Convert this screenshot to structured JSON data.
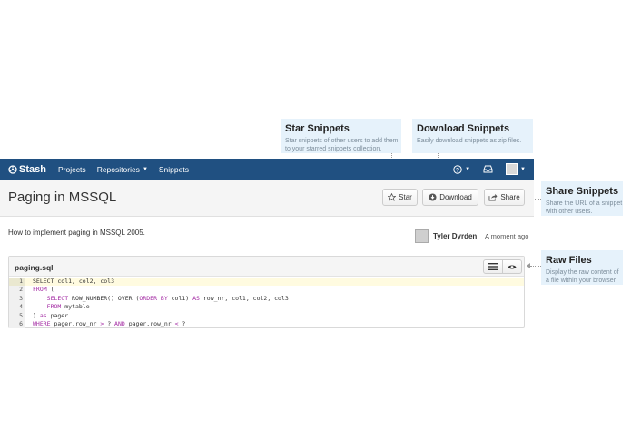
{
  "callouts": {
    "star": {
      "title": "Star Snippets",
      "desc1": "Star snippets of other users to add them",
      "desc2": "to your starred snippets collection."
    },
    "download": {
      "title": "Download Snippets",
      "desc1": "Easily download snippets as zip files."
    },
    "share": {
      "title": "Share Snippets",
      "desc1": "Share the URL of a snippet",
      "desc2": "with other users."
    },
    "raw": {
      "title": "Raw Files",
      "desc1": "Display the raw content of",
      "desc2": "a file within your browser."
    }
  },
  "navbar": {
    "brand": "Stash",
    "items": [
      "Projects",
      "Repositories",
      "Snippets"
    ],
    "help_icon": "help-icon",
    "inbox_icon": "inbox-icon",
    "colors": {
      "bar": "#205081"
    }
  },
  "header": {
    "title": "Paging in MSSQL",
    "star_label": "Star",
    "download_label": "Download",
    "share_label": "Share"
  },
  "snippet": {
    "description": "How to implement paging in MSSQL 2005.",
    "author": "Tyler Dyrden",
    "timestamp": "A moment ago"
  },
  "file": {
    "name": "paging.sql",
    "lines": [
      {
        "num": "1",
        "tokens": [
          [
            "",
            "SELECT col1, col2, col3"
          ]
        ]
      },
      {
        "num": "2",
        "tokens": [
          [
            "kw",
            "FROM"
          ],
          [
            "",
            " ("
          ]
        ]
      },
      {
        "num": "3",
        "tokens": [
          [
            "",
            "    "
          ],
          [
            "kw",
            "SELECT"
          ],
          [
            "",
            " ROW_NUMBER() OVER ("
          ],
          [
            "kw",
            "ORDER BY"
          ],
          [
            "",
            " col1) "
          ],
          [
            "kw",
            "AS"
          ],
          [
            "",
            " row_nr, col1, col2, col3"
          ]
        ]
      },
      {
        "num": "4",
        "tokens": [
          [
            "",
            "    "
          ],
          [
            "kw",
            "FROM"
          ],
          [
            "",
            " mytable"
          ]
        ]
      },
      {
        "num": "5",
        "tokens": [
          [
            "",
            ") "
          ],
          [
            "kw",
            "as"
          ],
          [
            "",
            " pager"
          ]
        ]
      },
      {
        "num": "6",
        "tokens": [
          [
            "kw",
            "WHERE"
          ],
          [
            "",
            " pager.row_nr "
          ],
          [
            "kw",
            ">"
          ],
          [
            "",
            " ? "
          ],
          [
            "kw",
            "AND"
          ],
          [
            "",
            " pager.row_nr "
          ],
          [
            "kw",
            "<"
          ],
          [
            "",
            " ?"
          ]
        ]
      }
    ]
  }
}
